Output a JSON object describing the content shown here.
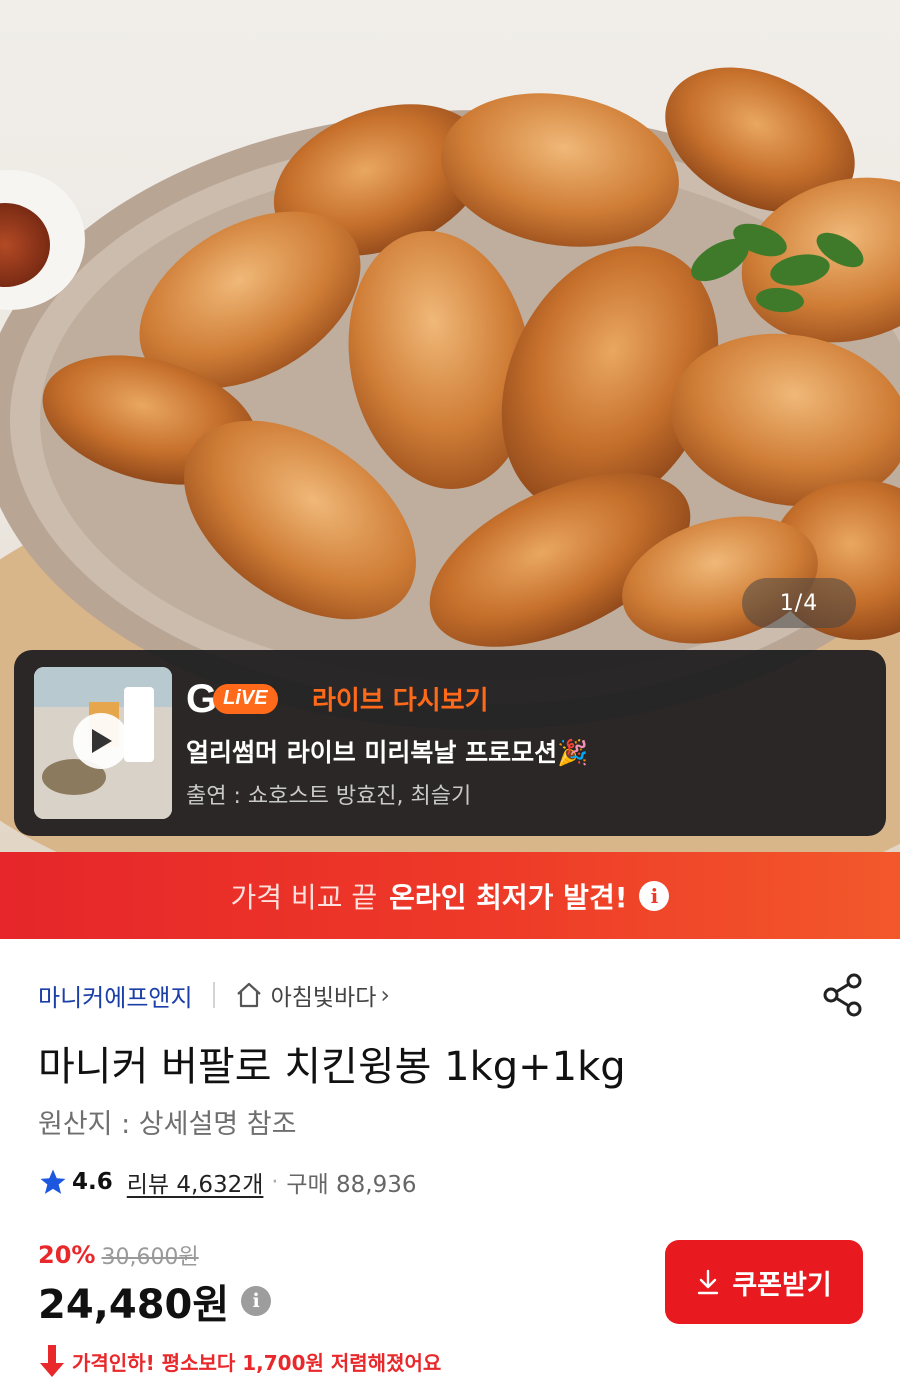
{
  "hero": {
    "image_counter": "1/4"
  },
  "live": {
    "logo_letter": "G",
    "logo_badge": "LiVE",
    "replay_label": "라이브 다시보기",
    "title": "얼리썸머 라이브 미리복날 프로모션🎉",
    "cast": "출연 : 쇼호스트 방효진, 최슬기"
  },
  "promo": {
    "text_normal": "가격 비교 끝",
    "text_bold": "온라인 최저가 발견!",
    "info_icon": "i"
  },
  "product": {
    "brand": "마니커에프앤지",
    "store": "아침빛바다",
    "store_chevron": "›",
    "title": "마니커 버팔로 치킨윙봉 1kg+1kg",
    "origin": "원산지 : 상세설명 참조",
    "rating": "4.6",
    "reviews": "리뷰 4,632개",
    "separator": "·",
    "purchases": "구매 88,936",
    "discount": "20%",
    "original_price": "30,600원",
    "price": "24,480원",
    "price_info_icon": "i",
    "coupon_label": "쿠폰받기",
    "price_drop": "가격인하! 평소보다 1,700원 저렴해졌어요"
  },
  "colors": {
    "accent_red": "#e8191f",
    "live_orange": "#ff6a1a",
    "brand_blue": "#1b3fa8",
    "star_blue": "#1d57e0"
  },
  "icons": {
    "share": "share-icon",
    "store": "home-icon",
    "star": "star-icon",
    "play": "play-icon",
    "download": "download-arrow-icon",
    "price_drop": "down-arrow-icon"
  }
}
